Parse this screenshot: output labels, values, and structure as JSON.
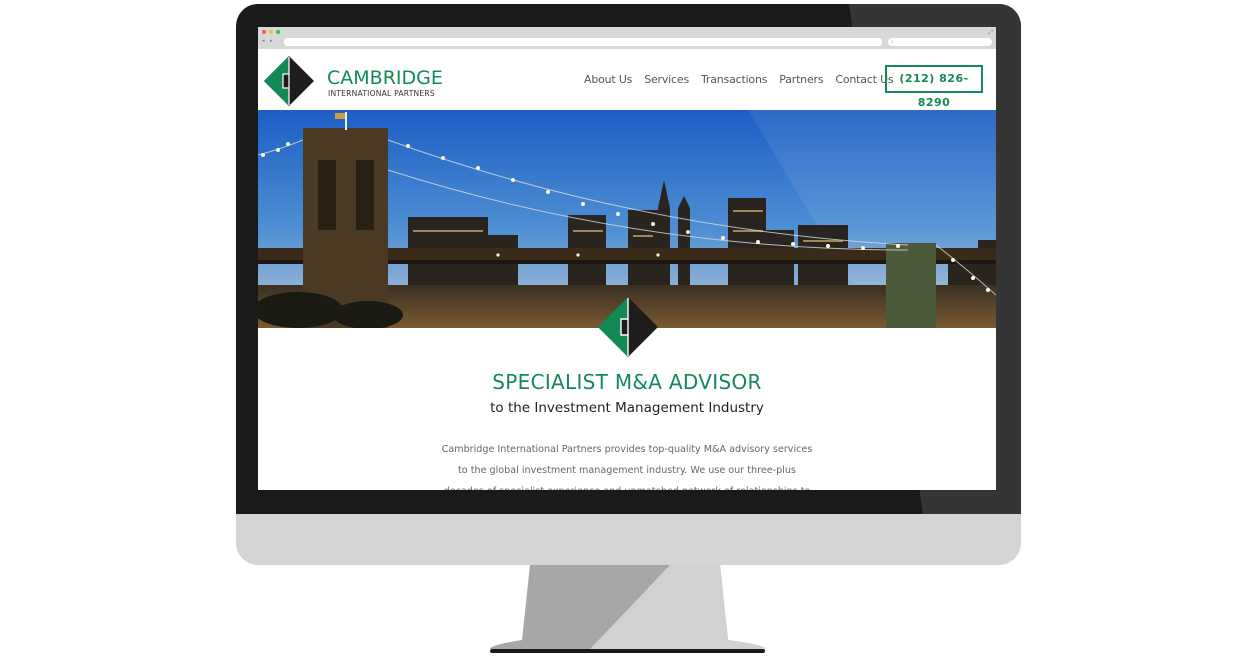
{
  "browser": {
    "url_placeholder": "·",
    "search_placeholder": "⌕",
    "nav_arrows": "◂ ▸",
    "expand_icon": "⤢",
    "traffic_lights": {
      "close": "#f05a5a",
      "minimize": "#f5bd3c",
      "maximize": "#3cc24a"
    }
  },
  "site": {
    "brand_color": "#138a55",
    "logo": {
      "name": "CAMBRIDGE",
      "subtitle": "INTERNATIONAL PARTNERS"
    },
    "nav": [
      {
        "label": "About Us"
      },
      {
        "label": "Services"
      },
      {
        "label": "Transactions"
      },
      {
        "label": "Partners"
      },
      {
        "label": "Contact Us"
      }
    ],
    "phone": "(212) 826-8290",
    "hero": {
      "description": "Brooklyn Bridge at dusk with Manhattan skyline"
    },
    "headline": "SPECIALIST M&A ADVISOR",
    "subheadline": "to the Investment Management Industry",
    "body": "Cambridge International Partners provides top-quality M&A advisory services to the global investment management industry. We use our three-plus decades of specialist experience and unmatched network of relationships to help our clients achieve"
  }
}
